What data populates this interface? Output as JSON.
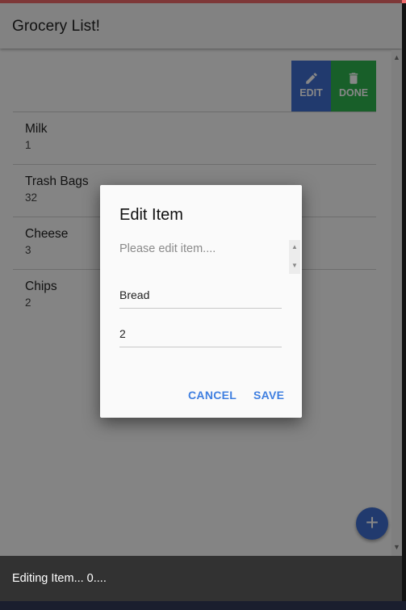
{
  "app": {
    "title": "Grocery List!"
  },
  "toolbar": {
    "edit_label": "EDIT",
    "done_label": "DONE",
    "edit_icon": "pencil-icon",
    "done_icon": "trash-icon"
  },
  "list": {
    "items": [
      {
        "name": "Milk",
        "qty": "1"
      },
      {
        "name": "Trash Bags",
        "qty": "32"
      },
      {
        "name": "Cheese",
        "qty": "3"
      },
      {
        "name": "Chips",
        "qty": "2"
      }
    ]
  },
  "dialog": {
    "title": "Edit Item",
    "message": "Please edit item....",
    "name_value": "Bread",
    "qty_value": "2",
    "cancel_label": "CANCEL",
    "save_label": "SAVE"
  },
  "fab": {
    "label": "+",
    "icon": "plus-icon"
  },
  "snackbar": {
    "message": "Editing Item... 0...."
  },
  "colors": {
    "accent_blue": "#3f6fd0",
    "done_green": "#2fb34f",
    "dialog_button": "#3f7fe0",
    "top_accent": "#ee6b6b"
  }
}
